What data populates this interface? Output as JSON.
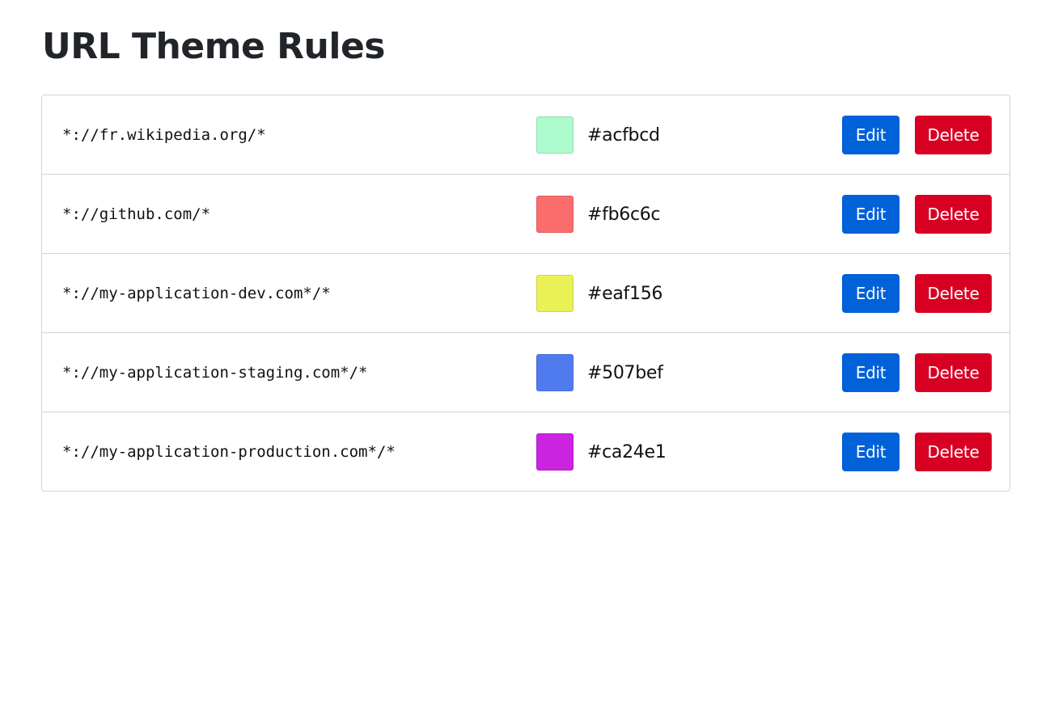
{
  "page": {
    "title": "URL Theme Rules"
  },
  "rules": [
    {
      "pattern": "*://fr.wikipedia.org/*",
      "color": "#acfbcd",
      "edit_label": "Edit",
      "delete_label": "Delete"
    },
    {
      "pattern": "*://github.com/*",
      "color": "#fb6c6c",
      "edit_label": "Edit",
      "delete_label": "Delete"
    },
    {
      "pattern": "*://my-application-dev.com*/*",
      "color": "#eaf156",
      "edit_label": "Edit",
      "delete_label": "Delete"
    },
    {
      "pattern": "*://my-application-staging.com*/*",
      "color": "#507bef",
      "edit_label": "Edit",
      "delete_label": "Delete"
    },
    {
      "pattern": "*://my-application-production.com*/*",
      "color": "#ca24e1",
      "edit_label": "Edit",
      "delete_label": "Delete"
    }
  ],
  "colors": {
    "edit_button": "#0061d9",
    "delete_button": "#d70022",
    "border": "#d0d3d6"
  }
}
